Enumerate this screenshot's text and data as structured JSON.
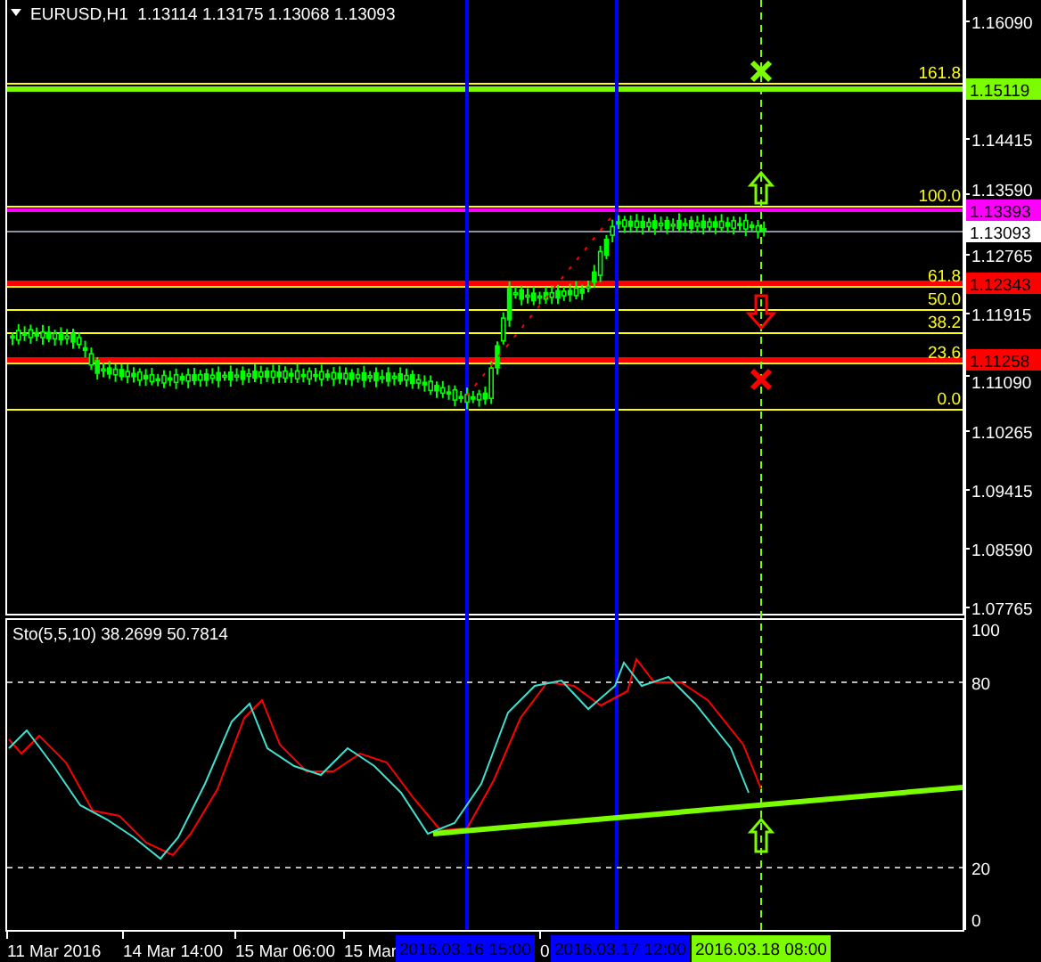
{
  "title": "EURUSD,H1  1.13114 1.13175 1.13068 1.13093",
  "price_axis": {
    "labels": [
      "1.16090",
      "1.14415",
      "1.13590",
      "1.12765",
      "1.11915",
      "1.11090",
      "1.10265",
      "1.09415",
      "1.08590",
      "1.07765"
    ]
  },
  "price_tags": [
    {
      "text": "1.15119",
      "color": "#7cfc00"
    },
    {
      "text": "1.13393",
      "color": "#ff00ff"
    },
    {
      "text": "1.13093",
      "color": "#ffffff"
    },
    {
      "text": "1.12343",
      "color": "#ff0000"
    },
    {
      "text": "1.11258",
      "color": "#ff0000"
    }
  ],
  "fibonacci_levels": [
    {
      "label": "161.8"
    },
    {
      "label": "100.0"
    },
    {
      "label": "61.8"
    },
    {
      "label": "50.0"
    },
    {
      "label": "38.2"
    },
    {
      "label": "23.6"
    },
    {
      "label": "0.0"
    }
  ],
  "indicator": {
    "label": "Sto(5,5,10) 38.2699 50.7814",
    "axis_labels": [
      "100",
      "80",
      "20",
      "0"
    ]
  },
  "time_axis": {
    "labels": [
      "11 Mar 2016",
      "14 Mar 14:00",
      "15 Mar 06:00",
      "15 Mar",
      "0"
    ],
    "cursor_tags": [
      {
        "text": "2016.03.16 15:00",
        "color": "#0000ff"
      },
      {
        "text": "2016.03.17 12:00",
        "color": "#0000ff"
      },
      {
        "text": "2016.03.18 08:00",
        "color": "#7cfc00"
      }
    ]
  }
}
